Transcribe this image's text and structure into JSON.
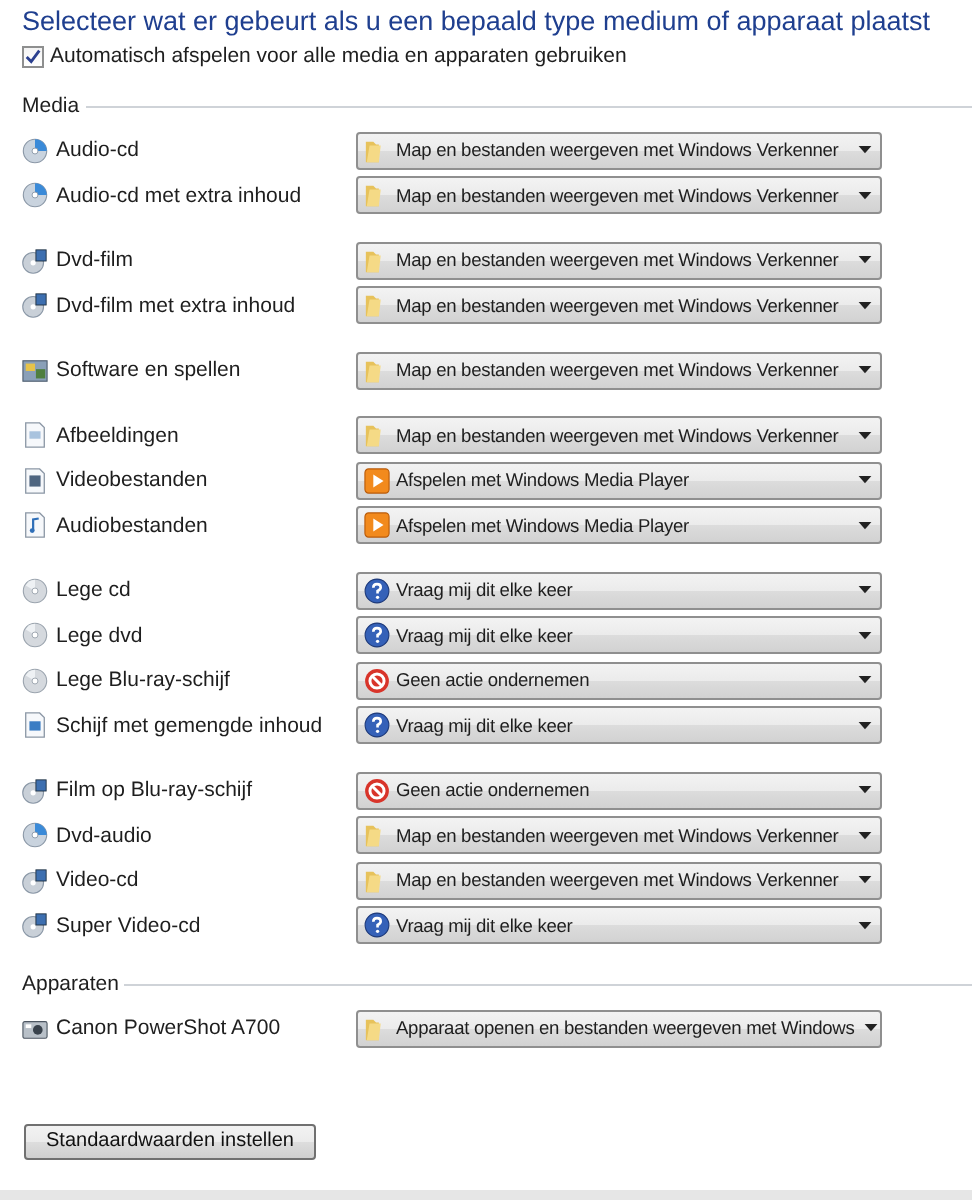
{
  "title": "Selecteer wat er gebeurt als u een bepaald type medium of apparaat plaatst",
  "autoplay": {
    "label": "Automatisch afspelen voor alle media en apparaten gebruiken",
    "checked": true
  },
  "sections": [
    {
      "heading": "Media",
      "groups": [
        [
          {
            "label": "Audio-cd",
            "kind": "disc",
            "action": {
              "text": "Map en bestanden weergeven met Windows Verkenner",
              "kind": "folder"
            }
          },
          {
            "label": "Audio-cd met extra inhoud",
            "kind": "disc",
            "action": {
              "text": "Map en bestanden weergeven met Windows Verkenner",
              "kind": "folder"
            }
          }
        ],
        [
          {
            "label": "Dvd-film",
            "kind": "film-disc",
            "action": {
              "text": "Map en bestanden weergeven met Windows Verkenner",
              "kind": "folder"
            }
          },
          {
            "label": "Dvd-film met extra inhoud",
            "kind": "film-disc",
            "action": {
              "text": "Map en bestanden weergeven met Windows Verkenner",
              "kind": "folder"
            }
          }
        ],
        [
          {
            "label": "Software en spellen",
            "kind": "software",
            "action": {
              "text": "Map en bestanden weergeven met Windows Verkenner",
              "kind": "folder"
            }
          }
        ],
        [
          {
            "label": "Afbeeldingen",
            "kind": "image-file",
            "action": {
              "text": "Map en bestanden weergeven met Windows Verkenner",
              "kind": "folder"
            }
          },
          {
            "label": "Videobestanden",
            "kind": "video-file",
            "action": {
              "text": "Afspelen met Windows Media Player",
              "kind": "play"
            }
          },
          {
            "label": "Audiobestanden",
            "kind": "audio-file",
            "action": {
              "text": "Afspelen met Windows Media Player",
              "kind": "play"
            }
          }
        ],
        [
          {
            "label": "Lege cd",
            "kind": "blank-disc",
            "action": {
              "text": "Vraag mij dit elke keer",
              "kind": "ask"
            }
          },
          {
            "label": "Lege dvd",
            "kind": "blank-disc",
            "action": {
              "text": "Vraag mij dit elke keer",
              "kind": "ask"
            }
          },
          {
            "label": "Lege Blu-ray-schijf",
            "kind": "blank-disc",
            "action": {
              "text": "Geen actie ondernemen",
              "kind": "none"
            }
          },
          {
            "label": "Schijf met gemengde inhoud",
            "kind": "mixed-file",
            "action": {
              "text": "Vraag mij dit elke keer",
              "kind": "ask"
            }
          }
        ],
        [
          {
            "label": "Film op Blu-ray-schijf",
            "kind": "film-disc",
            "action": {
              "text": "Geen actie ondernemen",
              "kind": "none"
            }
          },
          {
            "label": "Dvd-audio",
            "kind": "disc",
            "action": {
              "text": "Map en bestanden weergeven met Windows Verkenner",
              "kind": "folder"
            }
          },
          {
            "label": "Video-cd",
            "kind": "film-disc",
            "action": {
              "text": "Map en bestanden weergeven met Windows Verkenner",
              "kind": "folder"
            }
          },
          {
            "label": "Super Video-cd",
            "kind": "film-disc",
            "action": {
              "text": "Vraag mij dit elke keer",
              "kind": "ask"
            }
          }
        ]
      ]
    },
    {
      "heading": "Apparaten",
      "groups": [
        [
          {
            "label": "Canon PowerShot A700",
            "kind": "camera",
            "action": {
              "text": "Apparaat openen en bestanden weergeven met Windows",
              "kind": "folder"
            }
          }
        ]
      ]
    }
  ],
  "reset_button": "Standaardwaarden instellen"
}
